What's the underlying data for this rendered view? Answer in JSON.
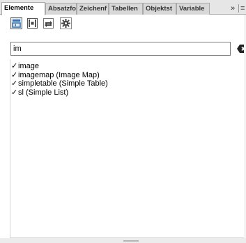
{
  "tabs": [
    {
      "label": "Elemente",
      "active": true
    },
    {
      "label": "Absatzfo",
      "active": false
    },
    {
      "label": "Zeichenf",
      "active": false
    },
    {
      "label": "Tabellen",
      "active": false
    },
    {
      "label": "Objektst",
      "active": false
    },
    {
      "label": "Variable",
      "active": false
    }
  ],
  "tab_overflow": "»",
  "tab_menu": "≡",
  "toolbar": {
    "icons": [
      "insert-element-icon",
      "wrap-element-icon",
      "change-element-icon",
      "settings-gear-icon"
    ]
  },
  "search": {
    "value": "im",
    "clear_icon": "clear-input-icon"
  },
  "elements": [
    {
      "check": "✓",
      "label": "image"
    },
    {
      "check": "✓",
      "label": "imagemap  (Image Map)"
    },
    {
      "check": "✓",
      "label": "simpletable  (Simple Table)"
    },
    {
      "check": "✓",
      "label": "sl  (Simple List)"
    }
  ],
  "colors": {
    "accent": "#3a6ea5",
    "tabbar_bg": "#e6e6e6"
  }
}
